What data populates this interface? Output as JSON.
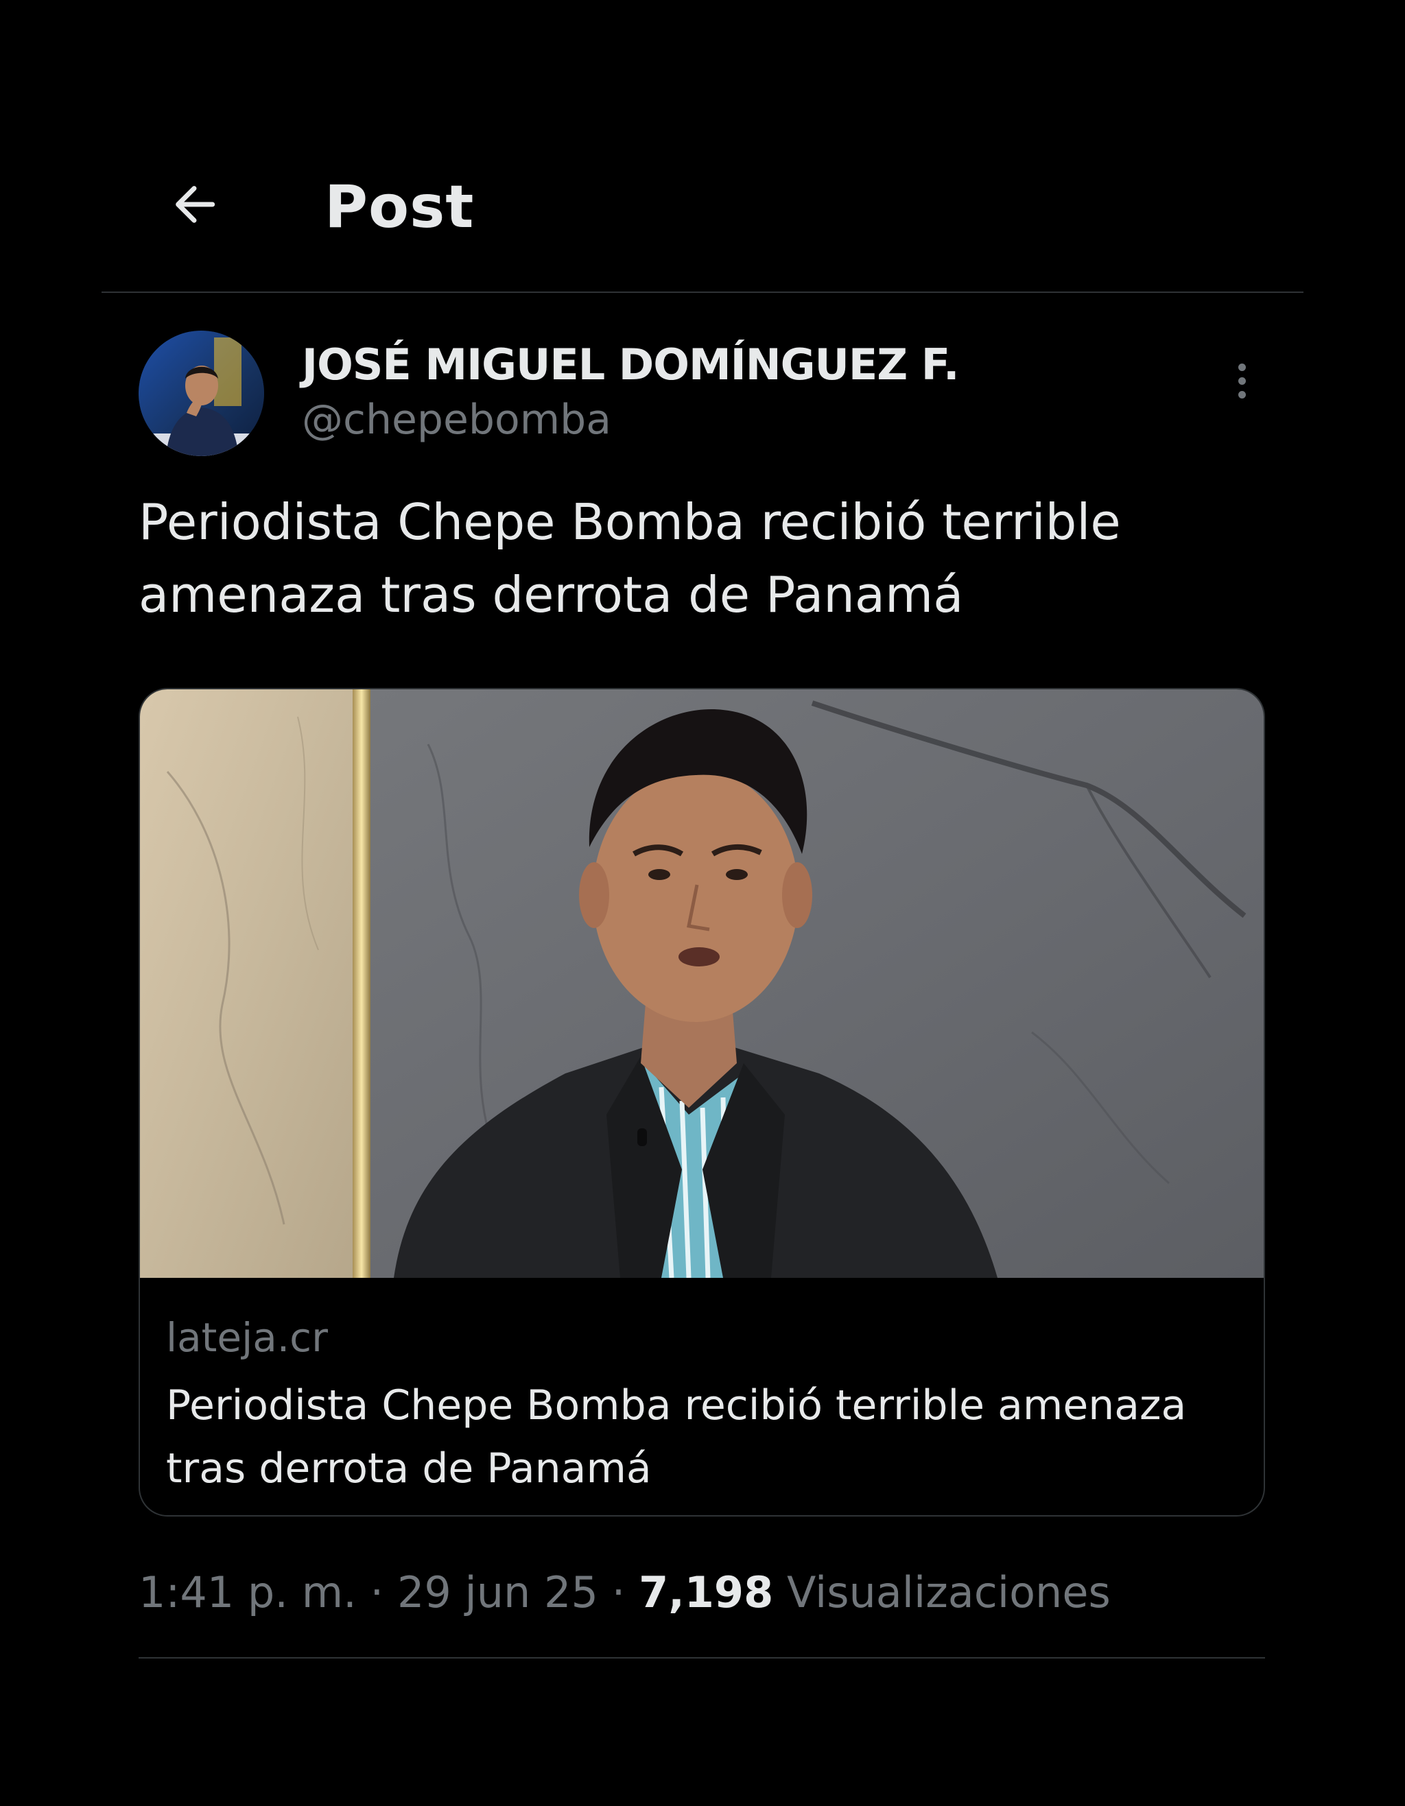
{
  "header": {
    "title": "Post",
    "back_icon": "arrow-left-icon"
  },
  "post": {
    "author": {
      "name": "JOSÉ MIGUEL DOMÍNGUEZ F.",
      "handle": "@chepebomba"
    },
    "more_icon": "more-vertical-icon",
    "text": "Periodista Chepe Bomba recibió terrible amenaza tras derrota de Panamá",
    "card": {
      "domain": "lateja.cr",
      "title": "Periodista Chepe Bomba recibió terrible amenaza tras derrota de Panamá"
    },
    "meta": {
      "time": "1:41 p. m.",
      "separator": " · ",
      "date": "29 jun 25",
      "views_count": "7,198",
      "views_label": "Visualizaciones"
    }
  },
  "colors": {
    "background": "#000000",
    "primary_text": "#e7e9ea",
    "secondary_text": "#71767b",
    "border": "#2f3336"
  }
}
